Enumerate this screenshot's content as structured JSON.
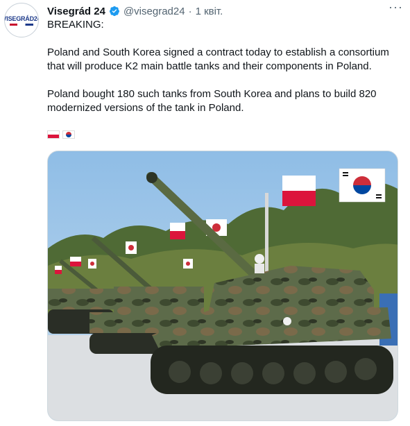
{
  "tweet": {
    "display_name": "Visegrád 24",
    "handle": "@visegrad24",
    "separator": "·",
    "date": "1 квіт.",
    "more_label": "···",
    "avatar_text": "VISEGRÁD24",
    "text": {
      "line1": "BREAKING:",
      "para2_line1": "Poland and South Korea signed a contract today to establish a consortium",
      "para2_line2": "that will produce K2 main battle tanks and their components in Poland.",
      "para3_line1": "Poland bought 180 such tanks from South Korea and plans to build 820",
      "para3_line2": "modernized versions of the tank in Poland."
    },
    "flags": [
      "poland-flag-emoji",
      "south-korea-flag-emoji"
    ],
    "verified_color": "#1d9bf0"
  }
}
